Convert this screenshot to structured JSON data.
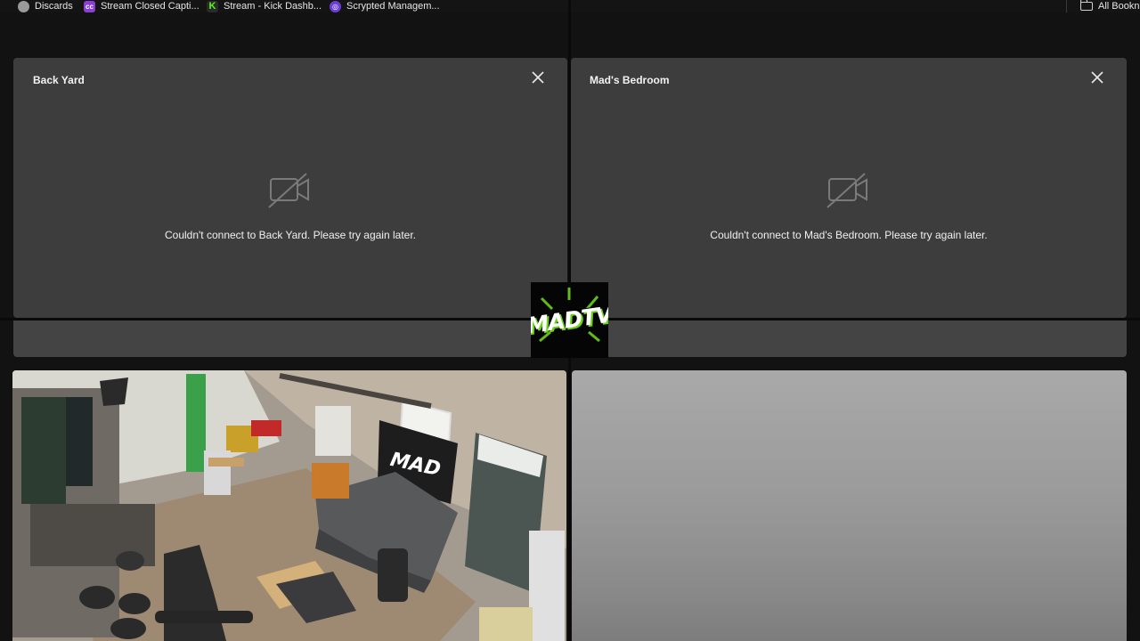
{
  "bookmarks": [
    {
      "label": "Discards",
      "icon": "globe-icon"
    },
    {
      "label": "Stream Closed Capti...",
      "icon": "captions-app-icon"
    },
    {
      "label": "Stream - Kick Dashb...",
      "icon": "kick-logo-icon"
    },
    {
      "label": "Scrypted Managem...",
      "icon": "scrypted-icon"
    }
  ],
  "all_bookmarks_label": "All Bookn",
  "cameras": [
    {
      "name": "Back Yard",
      "status": "Couldn't connect to Back Yard. Please try again later."
    },
    {
      "name": "Mad's Bedroom",
      "status": "Couldn't connect to Mad's Bedroom. Please try again later."
    }
  ],
  "logo": {
    "text": "MADTV",
    "accent_color": "#6bd11a"
  },
  "feeds": [
    {
      "id": "living-room-feed",
      "description": "live camera feed"
    },
    {
      "id": "grey-feed",
      "description": "live camera feed"
    }
  ],
  "colors": {
    "card_bg": "#3d3d3d",
    "page_bg": "#121212"
  }
}
